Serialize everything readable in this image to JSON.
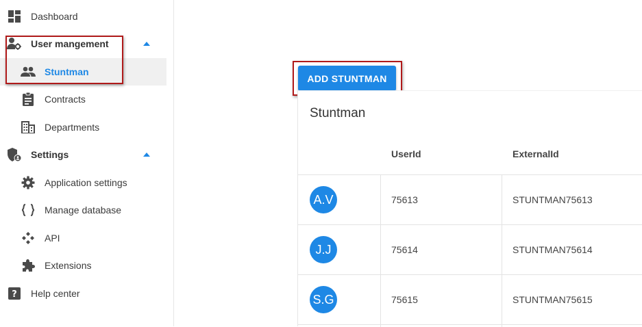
{
  "sidebar": {
    "dashboard": "Dashboard",
    "user_management": "User mangement",
    "stuntman": "Stuntman",
    "contracts": "Contracts",
    "departments": "Departments",
    "settings": "Settings",
    "application_settings": "Application settings",
    "manage_database": "Manage database",
    "api": "API",
    "extensions": "Extensions",
    "help_center": "Help center"
  },
  "main": {
    "add_button": "ADD STUNTMAN",
    "title": "Stuntman",
    "columns": [
      "",
      "UserId",
      "ExternalId"
    ],
    "rows": [
      {
        "initials": "A.V",
        "user_id": "75613",
        "external_id": "STUNTMAN75613"
      },
      {
        "initials": "J.J",
        "user_id": "75614",
        "external_id": "STUNTMAN75614"
      },
      {
        "initials": "S.G",
        "user_id": "75615",
        "external_id": "STUNTMAN75615"
      }
    ]
  },
  "colors": {
    "accent": "#1e88e5",
    "icon": "#4a4a4a",
    "highlight": "#b01a1a"
  }
}
